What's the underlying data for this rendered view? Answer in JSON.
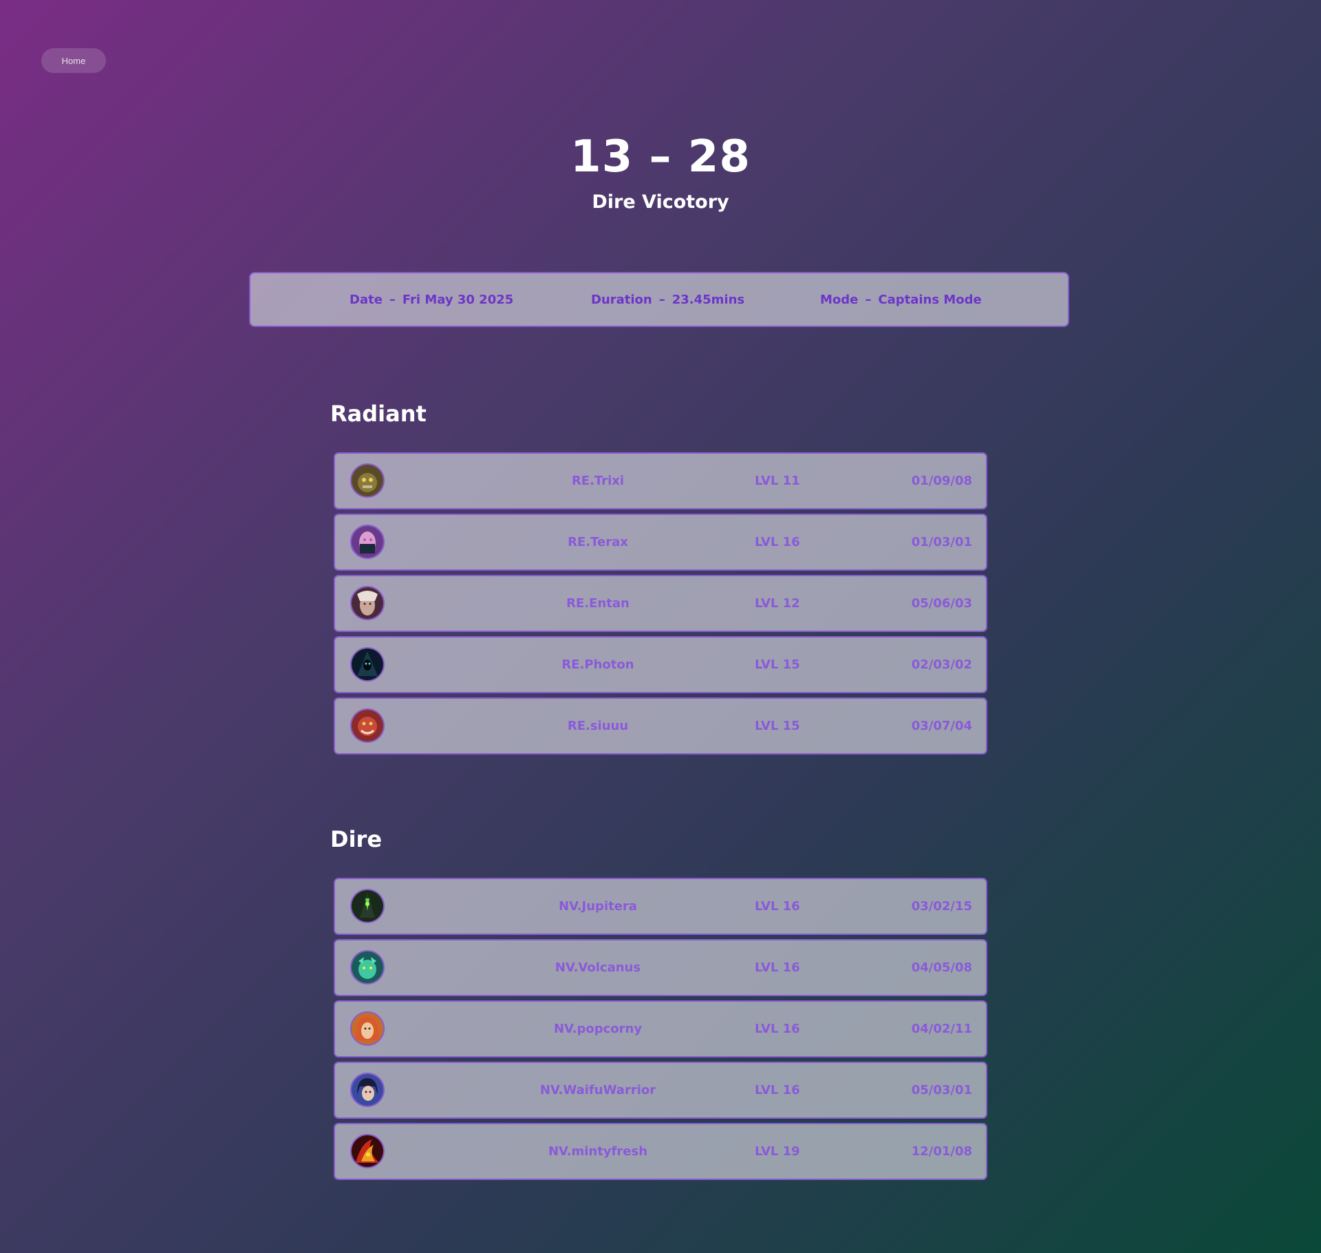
{
  "nav": {
    "home_label": "Home"
  },
  "match": {
    "score": "13 – 28",
    "result": "Dire Vicotory",
    "date_label": "Date",
    "date_value": "Fri May 30 2025",
    "duration_label": "Duration",
    "duration_value": "23.45mins",
    "mode_label": "Mode",
    "mode_value": "Captains Mode",
    "separator": "–"
  },
  "teams": {
    "radiant": {
      "title": "Radiant",
      "players": [
        {
          "name": "RE.Trixi",
          "level": "LVL 11",
          "kda": "01/09/08",
          "hero_icon": "hero-portrait-ogre"
        },
        {
          "name": "RE.Terax",
          "level": "LVL 16",
          "kda": "01/03/01",
          "hero_icon": "hero-portrait-masked"
        },
        {
          "name": "RE.Entan",
          "level": "LVL 12",
          "kda": "05/06/03",
          "hero_icon": "hero-portrait-pale"
        },
        {
          "name": "RE.Photon",
          "level": "LVL 15",
          "kda": "02/03/02",
          "hero_icon": "hero-portrait-hooded"
        },
        {
          "name": "RE.siuuu",
          "level": "LVL 15",
          "kda": "03/07/04",
          "hero_icon": "hero-portrait-red-beast"
        }
      ]
    },
    "dire": {
      "title": "Dire",
      "players": [
        {
          "name": "NV.Jupitera",
          "level": "LVL 16",
          "kda": "03/02/15",
          "hero_icon": "hero-portrait-green-shadow"
        },
        {
          "name": "NV.Volcanus",
          "level": "LVL 16",
          "kda": "04/05/08",
          "hero_icon": "hero-portrait-teal-creature"
        },
        {
          "name": "NV.popcorny",
          "level": "LVL 16",
          "kda": "04/02/11",
          "hero_icon": "hero-portrait-red-hair"
        },
        {
          "name": "NV.WaifuWarrior",
          "level": "LVL 16",
          "kda": "05/03/01",
          "hero_icon": "hero-portrait-dark-hair"
        },
        {
          "name": "NV.mintyfresh",
          "level": "LVL 19",
          "kda": "12/01/08",
          "hero_icon": "hero-portrait-fire"
        }
      ]
    }
  },
  "colors": {
    "accent": "#6c35c8",
    "row_text": "#8a5ad8",
    "border": "#8a5ad0"
  }
}
